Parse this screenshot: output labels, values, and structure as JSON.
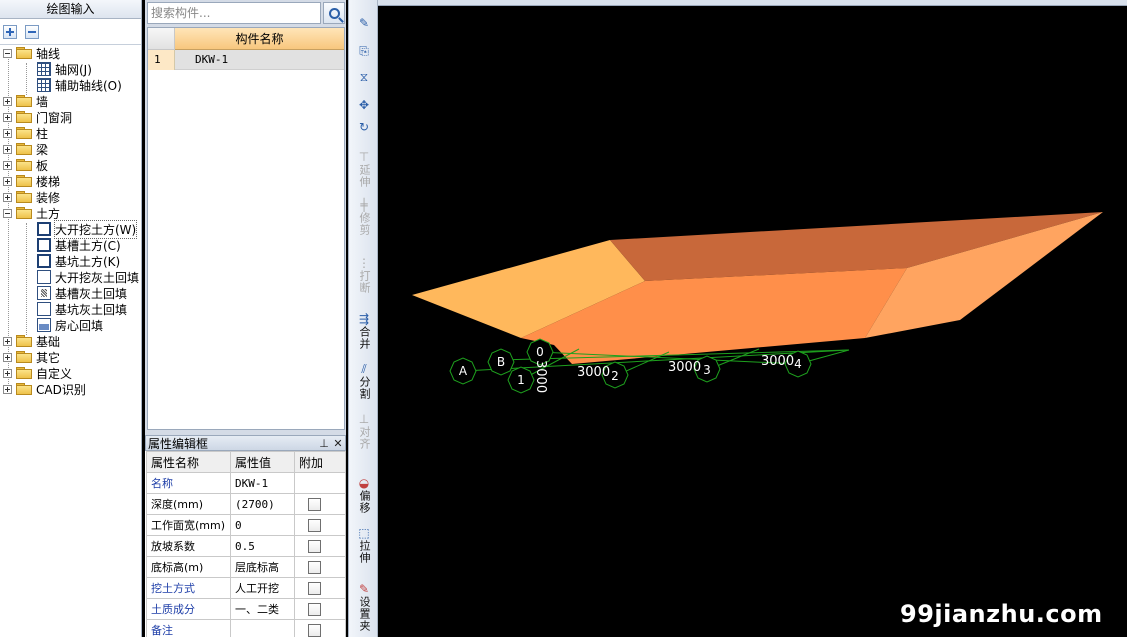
{
  "left_panel": {
    "title": "绘图输入",
    "tree": [
      {
        "label": "轴线",
        "expanded": true
      },
      {
        "label": "轴网(J)"
      },
      {
        "label": "辅助轴线(O)"
      },
      {
        "label": "墙"
      },
      {
        "label": "门窗洞"
      },
      {
        "label": "柱"
      },
      {
        "label": "梁"
      },
      {
        "label": "板"
      },
      {
        "label": "楼梯"
      },
      {
        "label": "装修"
      },
      {
        "label": "土方",
        "expanded": true
      },
      {
        "label": "大开挖土方(W)",
        "selected": true
      },
      {
        "label": "基槽土方(C)"
      },
      {
        "label": "基坑土方(K)"
      },
      {
        "label": "大开挖灰土回填"
      },
      {
        "label": "基槽灰土回填"
      },
      {
        "label": "基坑灰土回填"
      },
      {
        "label": "房心回填"
      },
      {
        "label": "基础"
      },
      {
        "label": "其它"
      },
      {
        "label": "自定义"
      },
      {
        "label": "CAD识别"
      }
    ]
  },
  "component_list": {
    "search_placeholder": "搜索构件...",
    "column_header": "构件名称",
    "rows": [
      {
        "index": "1",
        "name": "DKW-1"
      }
    ]
  },
  "property_panel": {
    "title": "属性编辑框",
    "pin_icon": "pin-icon",
    "close_icon": "close-icon",
    "headers": [
      "属性名称",
      "属性值",
      "附加"
    ],
    "rows": [
      {
        "name": "名称",
        "value": "DKW-1",
        "has_check": false,
        "blue": true
      },
      {
        "name": "深度(mm)",
        "value": "(2700)",
        "has_check": true,
        "blue": false
      },
      {
        "name": "工作面宽(mm)",
        "value": "0",
        "has_check": true,
        "blue": false
      },
      {
        "name": "放坡系数",
        "value": "0.5",
        "has_check": true,
        "blue": false
      },
      {
        "name": "底标高(m)",
        "value": "层底标高",
        "has_check": true,
        "blue": false
      },
      {
        "name": "挖土方式",
        "value": "人工开挖",
        "has_check": true,
        "blue": true
      },
      {
        "name": "土质成分",
        "value": "一、二类",
        "has_check": true,
        "blue": true
      },
      {
        "name": "备注",
        "value": "",
        "has_check": true,
        "blue": true
      }
    ]
  },
  "vertical_toolbar": {
    "tools": [
      {
        "label": "延伸",
        "icon": "extend-icon",
        "enabled": false
      },
      {
        "label": "修剪",
        "icon": "trim-icon",
        "enabled": false
      },
      {
        "label": "打断",
        "icon": "break-icon",
        "enabled": false
      },
      {
        "label": "合并",
        "icon": "merge-icon",
        "enabled": true
      },
      {
        "label": "分割",
        "icon": "split-icon",
        "enabled": true
      },
      {
        "label": "对齐",
        "icon": "align-icon",
        "enabled": false
      },
      {
        "label": "偏移",
        "icon": "offset-icon",
        "enabled": true
      },
      {
        "label": "拉伸",
        "icon": "stretch-icon",
        "enabled": true
      },
      {
        "label": "设置夹",
        "icon": "grip-icon",
        "enabled": true
      }
    ]
  },
  "viewport": {
    "axis_labels": [
      "A",
      "B",
      "0",
      "1",
      "2",
      "3",
      "4"
    ],
    "dimension_labels": [
      "3000",
      "3000",
      "3000",
      "3000"
    ],
    "colors": {
      "excavation_top": "#ffb85c",
      "excavation_back": "#c8683a",
      "excavation_front": "#ff8f4a",
      "excavation_side": "#ffa460",
      "axis_line": "#1ea01e",
      "background": "#000000"
    }
  },
  "watermark": "99jianzhu.com"
}
